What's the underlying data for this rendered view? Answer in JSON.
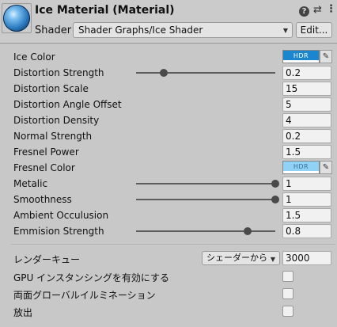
{
  "header": {
    "title": "Ice Material (Material)",
    "shader_label": "Shader",
    "shader_value": "Shader Graphs/Ice Shader",
    "edit_label": "Edit...",
    "help_icon": "?",
    "preset_icon": "⇄",
    "menu_icon": "⋮"
  },
  "properties": {
    "ice_color": {
      "label": "Ice Color",
      "color": "#1a86d0",
      "hdr": "HDR"
    },
    "distortion_strength": {
      "label": "Distortion Strength",
      "value": "0.2",
      "slider": 0.2
    },
    "distortion_scale": {
      "label": "Distortion Scale",
      "value": "15"
    },
    "distortion_angle_offset": {
      "label": "Distortion Angle Offset",
      "value": "5"
    },
    "distortion_density": {
      "label": "Distortion Density",
      "value": "4"
    },
    "normal_strength": {
      "label": "Normal Strength",
      "value": "0.2"
    },
    "fresnel_power": {
      "label": "Fresnel Power",
      "value": "1.5"
    },
    "fresnel_color": {
      "label": "Fresnel Color",
      "color": "#8fd2f5",
      "hdr": "HDR"
    },
    "metalic": {
      "label": "Metalic",
      "value": "1",
      "slider": 1.0
    },
    "smoothness": {
      "label": "Smoothness",
      "value": "1",
      "slider": 1.0
    },
    "ambient_occulusion": {
      "label": "Ambient Occulusion",
      "value": "1.5"
    },
    "emmision_strength": {
      "label": "Emmision Strength",
      "value": "0.8",
      "slider": 0.8
    }
  },
  "advanced": {
    "render_queue_label": "レンダーキュー",
    "render_queue_option": "シェーダーから",
    "render_queue_value": "3000",
    "gpu_instancing_label": "GPU インスタンシングを有効にする",
    "double_sided_gi_label": "両面グローバルイルミネーション",
    "emission_label": "放出"
  }
}
